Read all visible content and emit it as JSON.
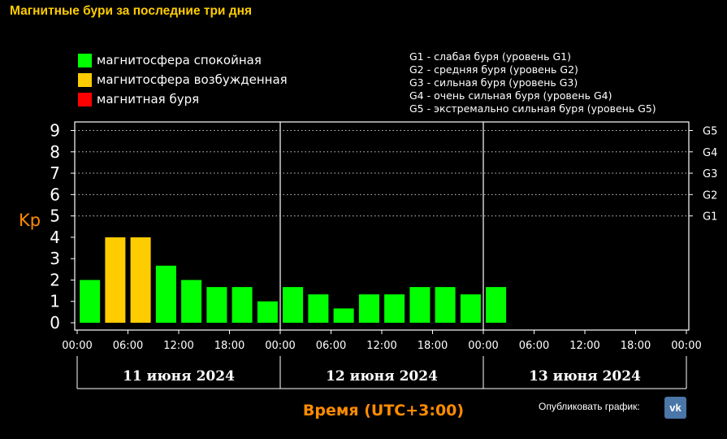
{
  "page": {
    "title": "Магнитные бури за последние три дня"
  },
  "legend": {
    "items": [
      {
        "label": "магнитосфера спокойная",
        "color": "#00ff00"
      },
      {
        "label": "магнитосфера возбужденная",
        "color": "#ffcc00"
      },
      {
        "label": "магнитная буря",
        "color": "#ff0000"
      }
    ]
  },
  "storm_levels": [
    "G1 - слабая буря (уровень G1)",
    "G2 - средняя буря (уровень G2)",
    "G3 - сильная буря (уровень G3)",
    "G4 - очень сильная буря (уровень G4)",
    "G5 - экстремально сильная буря (уровень G5)"
  ],
  "share": {
    "label": "Опубликовать график:",
    "button": "vk"
  },
  "colors": {
    "quiet": "#00ff00",
    "active": "#ffcc00",
    "storm": "#ff0000",
    "axis": "#ffffff",
    "accent": "#ff8c00"
  },
  "chart_data": {
    "type": "bar",
    "ylabel": "Kp",
    "xlabel": "Время (UTC+3:00)",
    "ylim": [
      0,
      9
    ],
    "yticks": [
      "0",
      "1",
      "2",
      "3",
      "4",
      "5",
      "6",
      "7",
      "8",
      "9"
    ],
    "right_ticks": [
      {
        "kp": 5,
        "label": "G1"
      },
      {
        "kp": 6,
        "label": "G2"
      },
      {
        "kp": 7,
        "label": "G3"
      },
      {
        "kp": 8,
        "label": "G4"
      },
      {
        "kp": 9,
        "label": "G5"
      }
    ],
    "xtick_labels": [
      "00:00",
      "06:00",
      "12:00",
      "18:00",
      "00:00",
      "06:00",
      "12:00",
      "18:00",
      "00:00",
      "06:00",
      "12:00",
      "18:00",
      "00:00"
    ],
    "days": [
      "11 июня 2024",
      "12 июня 2024",
      "13 июня 2024"
    ],
    "interval_hours": 3,
    "values": [
      2.0,
      4.0,
      4.0,
      2.67,
      2.0,
      1.67,
      1.67,
      1.0,
      1.67,
      1.33,
      0.67,
      1.33,
      1.33,
      1.67,
      1.67,
      1.33,
      1.67
    ],
    "bar_levels": [
      "quiet",
      "active",
      "active",
      "quiet",
      "quiet",
      "quiet",
      "quiet",
      "quiet",
      "quiet",
      "quiet",
      "quiet",
      "quiet",
      "quiet",
      "quiet",
      "quiet",
      "quiet",
      "quiet"
    ],
    "grid": "dotted horizontal at integer Kp levels 5-9",
    "legend_position": "top-left"
  }
}
